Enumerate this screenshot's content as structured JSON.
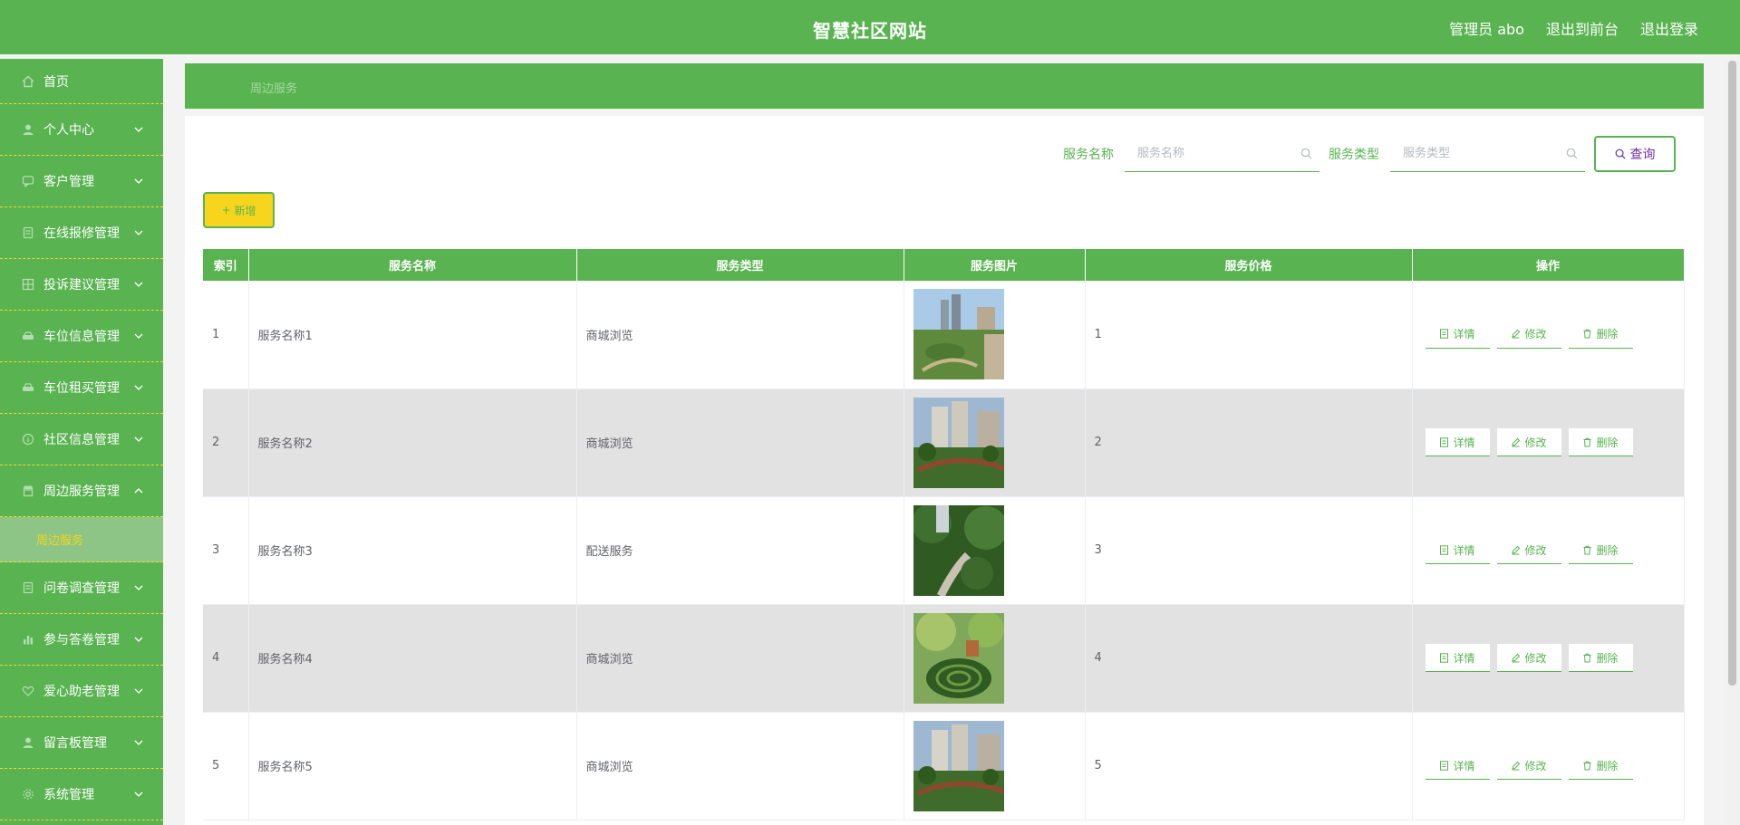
{
  "header": {
    "title": "智慧社区网站",
    "admin": "管理员 abo",
    "to_front": "退出到前台",
    "logout": "退出登录"
  },
  "sidebar": {
    "items": [
      {
        "label": "首页",
        "icon": "home-icon"
      },
      {
        "label": "个人中心",
        "icon": "user-icon"
      },
      {
        "label": "客户管理",
        "icon": "chat-icon"
      },
      {
        "label": "在线报修管理",
        "icon": "doc-icon"
      },
      {
        "label": "投诉建议管理",
        "icon": "grid-icon"
      },
      {
        "label": "车位信息管理",
        "icon": "car-icon"
      },
      {
        "label": "车位租买管理",
        "icon": "car-icon"
      },
      {
        "label": "社区信息管理",
        "icon": "info-icon"
      },
      {
        "label": "周边服务管理",
        "icon": "store-icon"
      },
      {
        "label": "问卷调查管理",
        "icon": "doc-icon"
      },
      {
        "label": "参与答卷管理",
        "icon": "chart-icon"
      },
      {
        "label": "爱心助老管理",
        "icon": "heart-icon"
      },
      {
        "label": "留言板管理",
        "icon": "user-icon"
      },
      {
        "label": "系统管理",
        "icon": "gear-icon"
      }
    ],
    "submenu": {
      "label": "周边服务"
    }
  },
  "breadcrumb": "周边服务",
  "search": {
    "name_label": "服务名称",
    "name_placeholder": "服务名称",
    "type_label": "服务类型",
    "type_placeholder": "服务类型",
    "query_label": "查询"
  },
  "add_label": "新增",
  "table": {
    "headers": [
      "索引",
      "服务名称",
      "服务类型",
      "服务图片",
      "服务价格",
      "操作"
    ],
    "rows": [
      {
        "index": "1",
        "name": "服务名称1",
        "type": "商城浏览",
        "price": "1"
      },
      {
        "index": "2",
        "name": "服务名称2",
        "type": "商城浏览",
        "price": "2"
      },
      {
        "index": "3",
        "name": "服务名称3",
        "type": "配送服务",
        "price": "3"
      },
      {
        "index": "4",
        "name": "服务名称4",
        "type": "商城浏览",
        "price": "4"
      },
      {
        "index": "5",
        "name": "服务名称5",
        "type": "商城浏览",
        "price": "5"
      }
    ],
    "actions": {
      "detail": "详情",
      "edit": "修改",
      "delete": "删除"
    }
  },
  "colors": {
    "primary": "#58b350",
    "accent": "#f7d51d",
    "stripe": "#e3e2e3"
  }
}
